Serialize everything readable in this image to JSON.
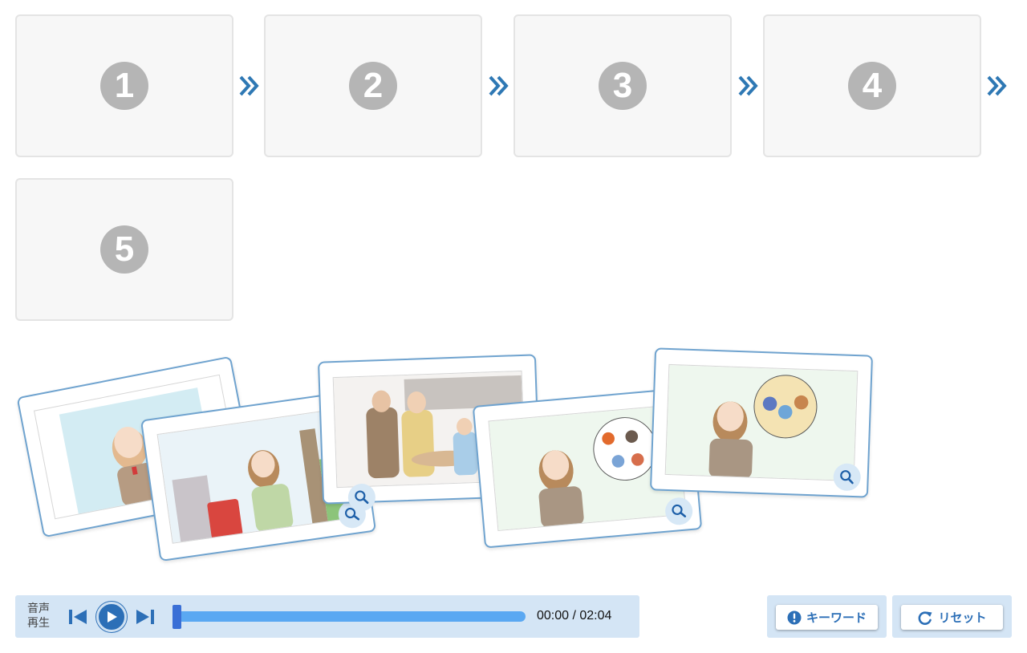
{
  "slots": [
    {
      "number": "1"
    },
    {
      "number": "2"
    },
    {
      "number": "3"
    },
    {
      "number": "4"
    },
    {
      "number": "5"
    }
  ],
  "colors": {
    "accent": "#2c6fb7",
    "arrow": "#2e78b4",
    "card_border": "#6fa3cf",
    "player_bg": "#d4e5f5",
    "track": "#5aa8f2",
    "slot_badge": "#b5b5b5"
  },
  "cards": [
    {
      "icon": "zoom-icon",
      "scene": "girl-smiling-on-phone"
    },
    {
      "icon": "zoom-icon",
      "scene": "girl-in-london-big-ben"
    },
    {
      "icon": "zoom-icon",
      "scene": "group-at-table"
    },
    {
      "icon": "zoom-icon",
      "scene": "girl-presenting-friends-bubble"
    },
    {
      "icon": "zoom-icon",
      "scene": "girl-presenting-family-bubble"
    }
  ],
  "player": {
    "label_line1": "音声",
    "label_line2": "再生",
    "time": "00:00 / 02:04",
    "progress": 0
  },
  "buttons": {
    "keyword": "キーワード",
    "reset": "リセット"
  }
}
